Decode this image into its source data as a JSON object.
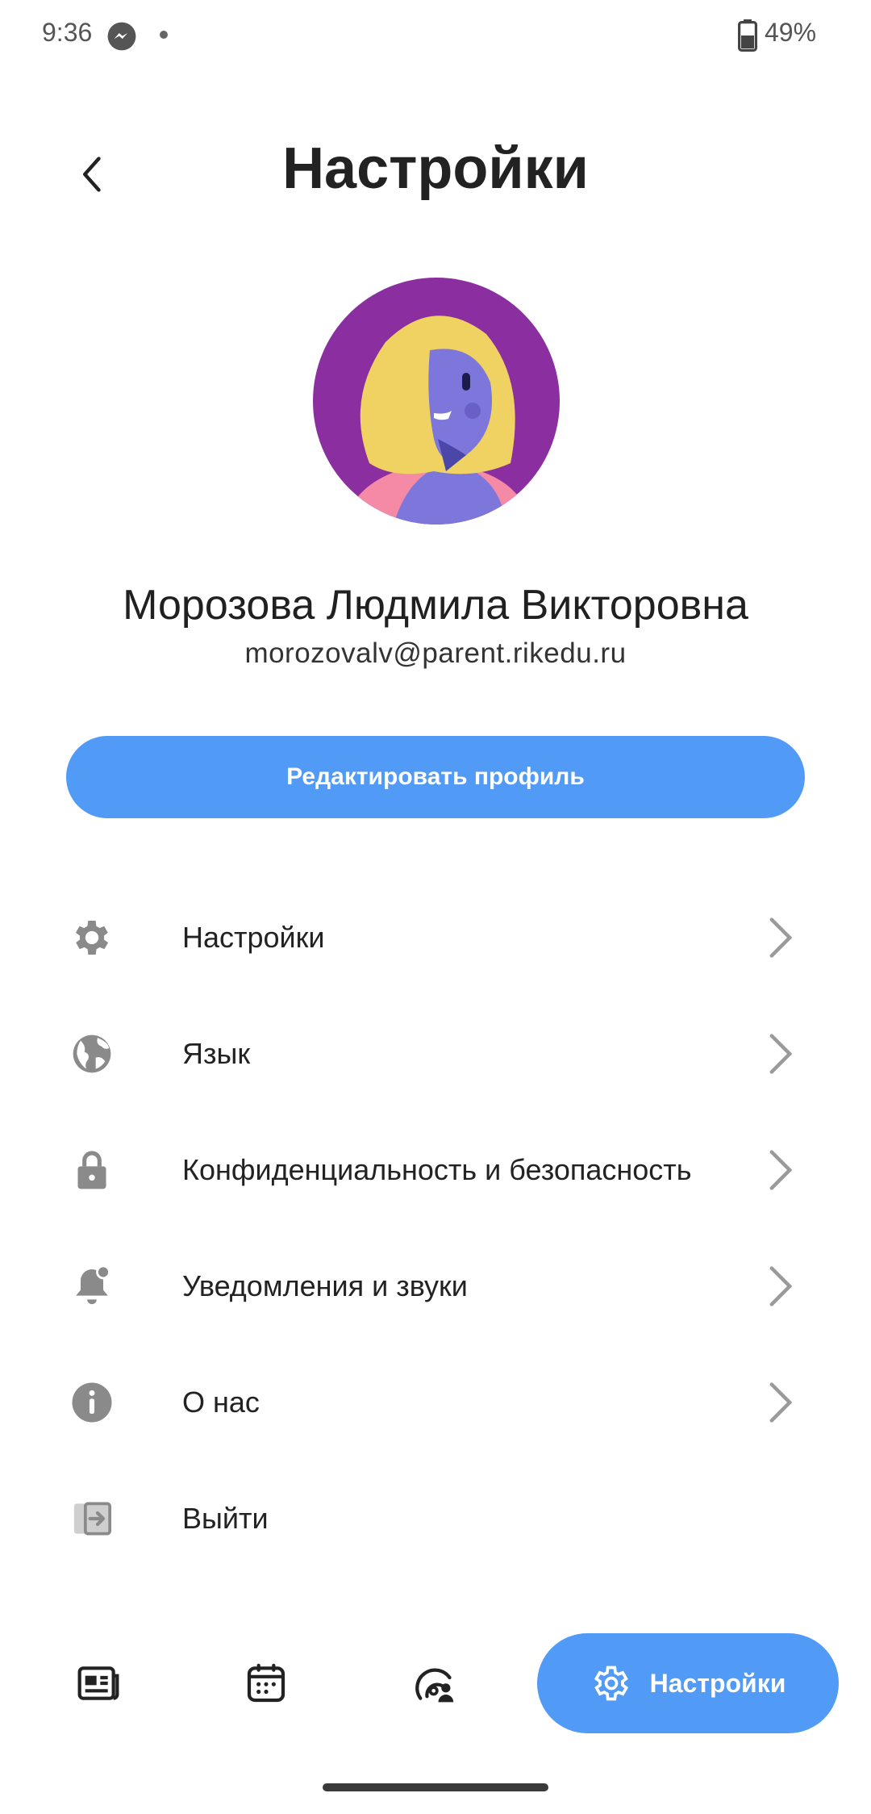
{
  "status": {
    "time": "9:36",
    "battery": "49%",
    "icons": [
      "messenger-icon",
      "dot-indicator",
      "battery-icon"
    ]
  },
  "header": {
    "title": "Настройки",
    "back_icon": "chevron-left-icon"
  },
  "profile": {
    "name": "Морозова Людмила Викторовна",
    "email": "morozovalv@parent.rikedu.ru",
    "edit_label": "Редактировать профиль"
  },
  "menu": {
    "items": [
      {
        "label": "Настройки",
        "icon": "gear-icon"
      },
      {
        "label": "Язык",
        "icon": "globe-icon"
      },
      {
        "label": "Конфиденциальность и безопасность",
        "icon": "lock-icon"
      },
      {
        "label": "Уведомления и звуки",
        "icon": "bell-icon"
      },
      {
        "label": "О нас",
        "icon": "info-icon"
      },
      {
        "label": "Выйти",
        "icon": "logout-icon"
      }
    ]
  },
  "nav": {
    "items": [
      "news-icon",
      "calendar-icon",
      "tracking-icon",
      "gear-icon"
    ],
    "active_label": "Настройки"
  },
  "colors": {
    "accent": "#519bf6",
    "icon_gray": "#8a8a8a",
    "avatar_bg": "#8b2fa0"
  }
}
